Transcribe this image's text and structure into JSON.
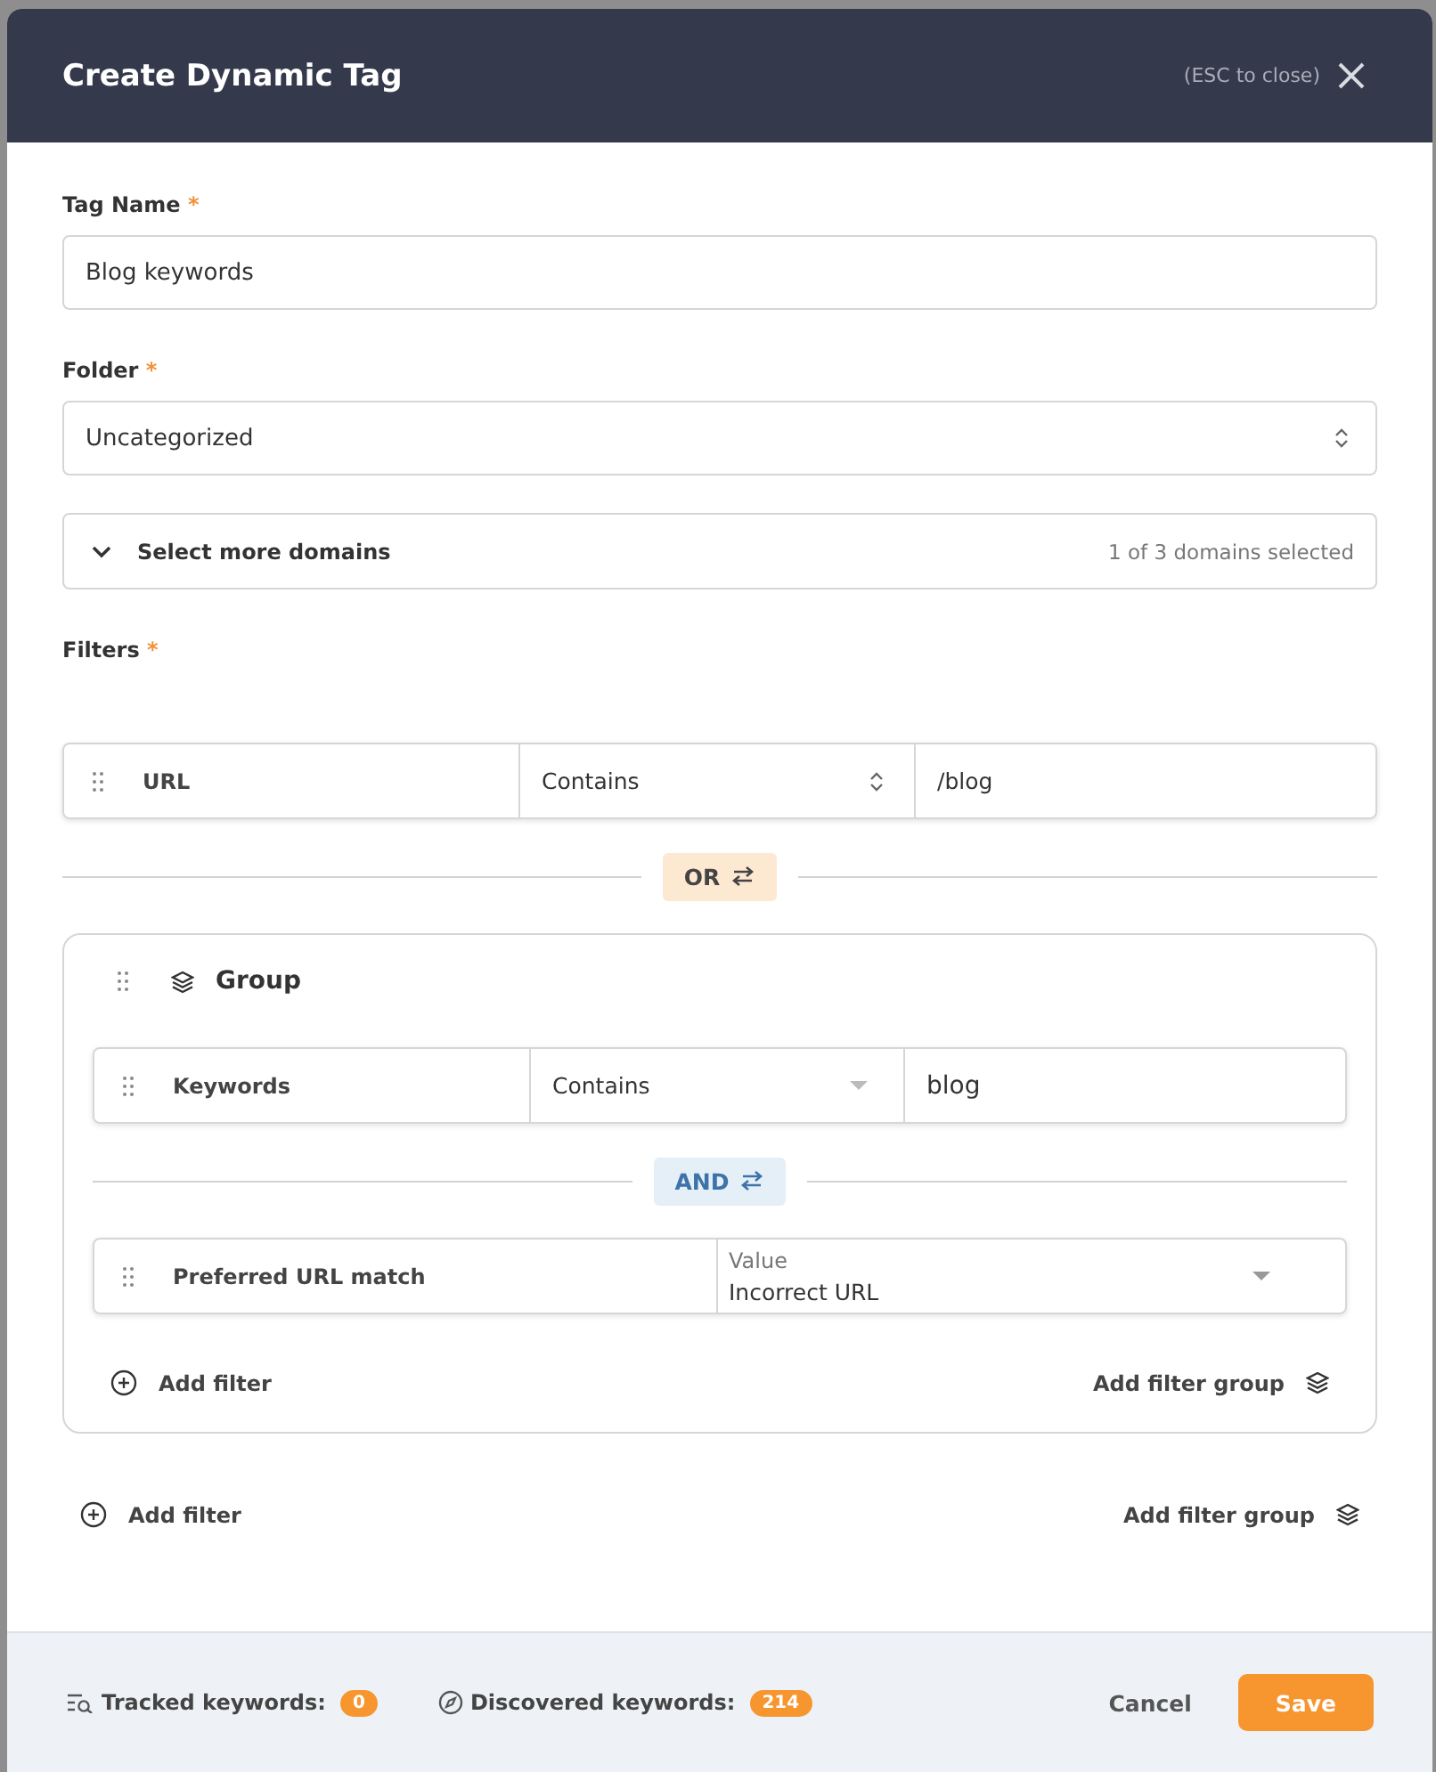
{
  "dialog": {
    "title": "Create Dynamic Tag",
    "close_hint": "(ESC to close)"
  },
  "tag_name": {
    "label": "Tag Name",
    "required_mark": "*",
    "value": "Blog keywords"
  },
  "folder": {
    "label": "Folder",
    "required_mark": "*",
    "value": "Uncategorized"
  },
  "domains": {
    "label": "Select more domains",
    "expanded": false,
    "summary": "1 of 3 domains selected"
  },
  "filters": {
    "label": "Filters",
    "required_mark": "*",
    "items": [
      {
        "kind": "stepper_rule",
        "field": "URL",
        "operator": "Contains",
        "value": "/blog"
      },
      {
        "kind": "or_link",
        "label": "OR"
      },
      {
        "kind": "group",
        "title": "Group",
        "items": [
          {
            "kind": "dropdown_rule",
            "field": "Keywords",
            "operator": "Contains",
            "value": "blog"
          },
          {
            "kind": "and_link",
            "label": "AND"
          },
          {
            "kind": "value_rule",
            "field": "Preferred URL match",
            "value_label": "Value",
            "value": "Incorrect URL"
          }
        ],
        "add_filter": "Add filter",
        "add_group": "Add filter group"
      }
    ],
    "add_filter": "Add filter",
    "add_group": "Add filter group"
  },
  "footer": {
    "tracked_label": "Tracked keywords:",
    "tracked_count": "0",
    "discovered_label": "Discovered keywords:",
    "discovered_count": "214",
    "cancel": "Cancel",
    "save": "Save"
  }
}
